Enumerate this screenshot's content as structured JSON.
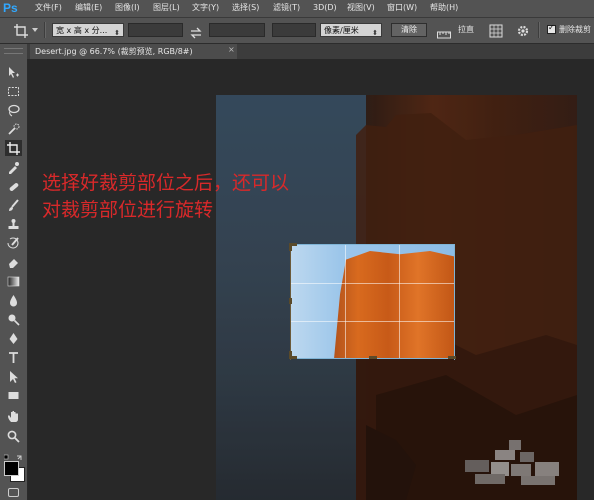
{
  "app": {
    "logo": "Ps"
  },
  "menu": [
    "文件(F)",
    "编辑(E)",
    "图像(I)",
    "图层(L)",
    "文字(Y)",
    "选择(S)",
    "滤镜(T)",
    "3D(D)",
    "视图(V)",
    "窗口(W)",
    "帮助(H)"
  ],
  "options": {
    "ratio_select": "宽 x 高 x 分...",
    "units_select": "像素/厘米",
    "clear_button": "清除",
    "straighten_label": "拉直",
    "delete_cropped_label": "删除裁剪"
  },
  "tab": {
    "title": "Desert.jpg @ 66.7% (裁剪预览, RGB/8#)"
  },
  "annotation": {
    "line1": "选择好裁剪部位之后，还可以",
    "line2": "对裁剪部位进行旋转"
  },
  "colors": {
    "annotation": "#d8292a",
    "crop_edge": "#7fb4d6",
    "ps_logo": "#31a8ff"
  },
  "tools": [
    "move-icon",
    "marquee-icon",
    "lasso-icon",
    "quick-select-icon",
    "crop-icon",
    "eyedropper-icon",
    "healing-brush-icon",
    "brush-icon",
    "clone-stamp-icon",
    "history-brush-icon",
    "eraser-icon",
    "gradient-icon",
    "blur-icon",
    "dodge-icon",
    "pen-icon",
    "type-icon",
    "path-select-icon",
    "shape-icon",
    "hand-icon",
    "zoom-icon"
  ]
}
